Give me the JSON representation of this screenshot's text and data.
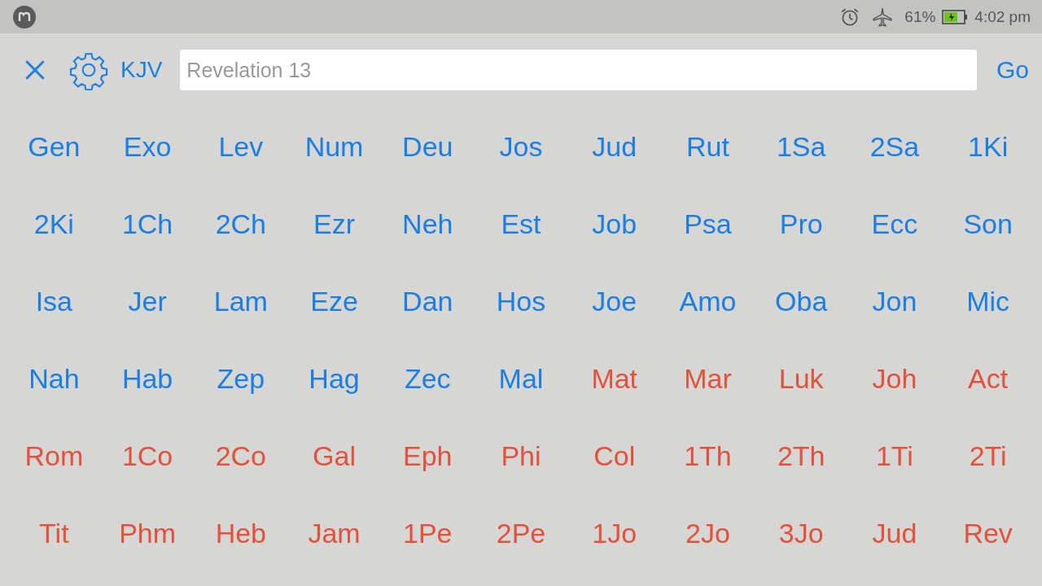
{
  "status_bar": {
    "battery": "61%",
    "time": "4:02 pm"
  },
  "toolbar": {
    "version": "KJV",
    "search": {
      "value": "Revelation 13"
    },
    "go": "Go"
  },
  "books": [
    {
      "label": "Gen",
      "color": "#1a7ee6"
    },
    {
      "label": "Exo",
      "color": "#1a7ee6"
    },
    {
      "label": "Lev",
      "color": "#1a7ee6"
    },
    {
      "label": "Num",
      "color": "#1a7ee6"
    },
    {
      "label": "Deu",
      "color": "#1a7ee6"
    },
    {
      "label": "Jos",
      "color": "#1a7ee6"
    },
    {
      "label": "Jud",
      "color": "#1a7ee6"
    },
    {
      "label": "Rut",
      "color": "#1a7ee6"
    },
    {
      "label": "1Sa",
      "color": "#1a7ee6"
    },
    {
      "label": "2Sa",
      "color": "#1a7ee6"
    },
    {
      "label": "1Ki",
      "color": "#1a7ee6"
    },
    {
      "label": "2Ki",
      "color": "#1a7ee6"
    },
    {
      "label": "1Ch",
      "color": "#1a7ee6"
    },
    {
      "label": "2Ch",
      "color": "#1a7ee6"
    },
    {
      "label": "Ezr",
      "color": "#1a7ee6"
    },
    {
      "label": "Neh",
      "color": "#1a7ee6"
    },
    {
      "label": "Est",
      "color": "#1a7ee6"
    },
    {
      "label": "Job",
      "color": "#1a7ee6"
    },
    {
      "label": "Psa",
      "color": "#1a7ee6"
    },
    {
      "label": "Pro",
      "color": "#1a7ee6"
    },
    {
      "label": "Ecc",
      "color": "#1a7ee6"
    },
    {
      "label": "Son",
      "color": "#1a7ee6"
    },
    {
      "label": "Isa",
      "color": "#1a7ee6"
    },
    {
      "label": "Jer",
      "color": "#1a7ee6"
    },
    {
      "label": "Lam",
      "color": "#1a7ee6"
    },
    {
      "label": "Eze",
      "color": "#1a7ee6"
    },
    {
      "label": "Dan",
      "color": "#1a7ee6"
    },
    {
      "label": "Hos",
      "color": "#1a7ee6"
    },
    {
      "label": "Joe",
      "color": "#1a7ee6"
    },
    {
      "label": "Amo",
      "color": "#1a7ee6"
    },
    {
      "label": "Oba",
      "color": "#1a7ee6"
    },
    {
      "label": "Jon",
      "color": "#1a7ee6"
    },
    {
      "label": "Mic",
      "color": "#1a7ee6"
    },
    {
      "label": "Nah",
      "color": "#1a7ee6"
    },
    {
      "label": "Hab",
      "color": "#1a7ee6"
    },
    {
      "label": "Zep",
      "color": "#1a7ee6"
    },
    {
      "label": "Hag",
      "color": "#1a7ee6"
    },
    {
      "label": "Zec",
      "color": "#1a7ee6"
    },
    {
      "label": "Mal",
      "color": "#1a7ee6"
    },
    {
      "label": "Mat",
      "color": "#e5503a"
    },
    {
      "label": "Mar",
      "color": "#e5503a"
    },
    {
      "label": "Luk",
      "color": "#e5503a"
    },
    {
      "label": "Joh",
      "color": "#e5503a"
    },
    {
      "label": "Act",
      "color": "#e5503a"
    },
    {
      "label": "Rom",
      "color": "#e5503a"
    },
    {
      "label": "1Co",
      "color": "#e5503a"
    },
    {
      "label": "2Co",
      "color": "#e5503a"
    },
    {
      "label": "Gal",
      "color": "#e5503a"
    },
    {
      "label": "Eph",
      "color": "#e5503a"
    },
    {
      "label": "Phi",
      "color": "#e5503a"
    },
    {
      "label": "Col",
      "color": "#e5503a"
    },
    {
      "label": "1Th",
      "color": "#e5503a"
    },
    {
      "label": "2Th",
      "color": "#e5503a"
    },
    {
      "label": "1Ti",
      "color": "#e5503a"
    },
    {
      "label": "2Ti",
      "color": "#e5503a"
    },
    {
      "label": "Tit",
      "color": "#e5503a"
    },
    {
      "label": "Phm",
      "color": "#e5503a"
    },
    {
      "label": "Heb",
      "color": "#e5503a"
    },
    {
      "label": "Jam",
      "color": "#e5503a"
    },
    {
      "label": "1Pe",
      "color": "#e5503a"
    },
    {
      "label": "2Pe",
      "color": "#e5503a"
    },
    {
      "label": "1Jo",
      "color": "#e5503a"
    },
    {
      "label": "2Jo",
      "color": "#e5503a"
    },
    {
      "label": "3Jo",
      "color": "#e5503a"
    },
    {
      "label": "Jud",
      "color": "#e5503a"
    },
    {
      "label": "Rev",
      "color": "#e5503a"
    }
  ]
}
